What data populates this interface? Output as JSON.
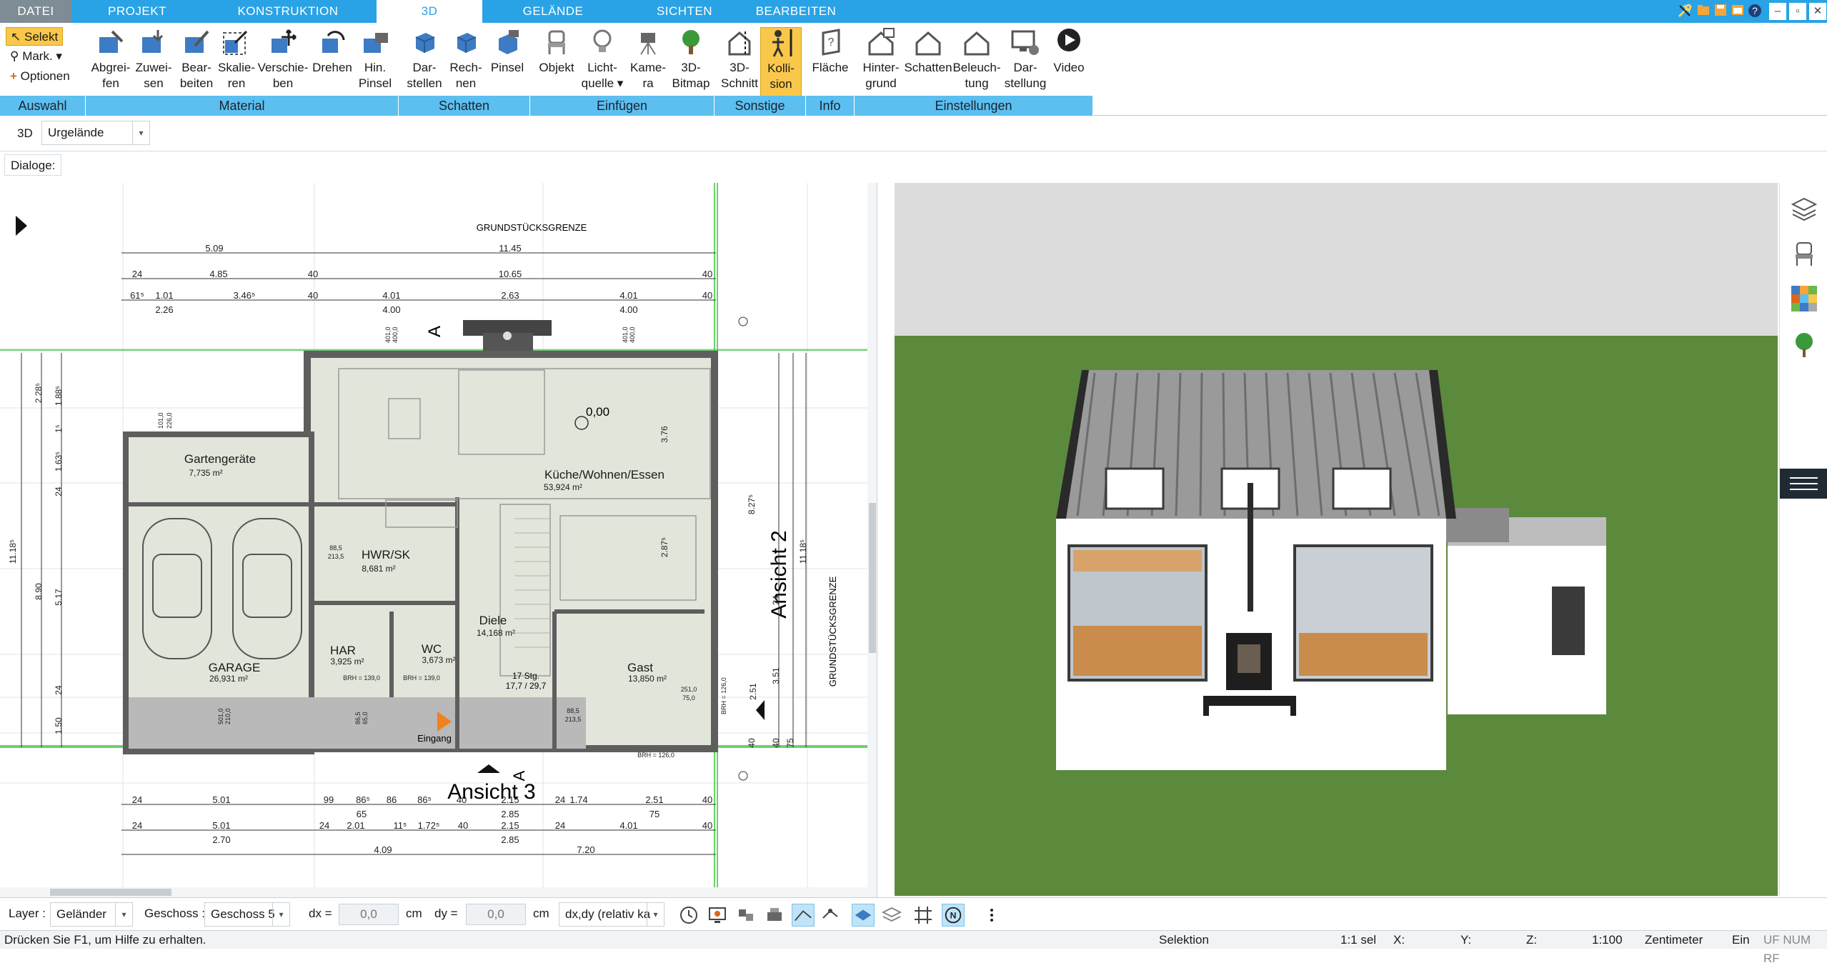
{
  "tabs": [
    {
      "label": "DATEI",
      "active": false
    },
    {
      "label": "PROJEKT",
      "active": false
    },
    {
      "label": "KONSTRUKTION",
      "active": false
    },
    {
      "label": "3D",
      "active": true
    },
    {
      "label": "GELÄNDE",
      "active": false
    },
    {
      "label": "SICHTEN",
      "active": false
    },
    {
      "label": "BEARBEITEN",
      "active": false
    }
  ],
  "auswahl": {
    "select": "Selekt",
    "mark": "Mark.",
    "options": "Optionen",
    "group": "Auswahl"
  },
  "ribbon": {
    "material": {
      "group": "Material",
      "buttons": [
        {
          "l1": "Abgrei-",
          "l2": "fen"
        },
        {
          "l1": "Zuwei-",
          "l2": "sen"
        },
        {
          "l1": "Bear-",
          "l2": "beiten"
        },
        {
          "l1": "Skalie-",
          "l2": "ren"
        },
        {
          "l1": "Verschie-",
          "l2": "ben"
        },
        {
          "l1": "Drehen",
          "l2": ""
        },
        {
          "l1": "Hin.",
          "l2": "Pinsel"
        }
      ]
    },
    "schatten": {
      "group": "Schatten",
      "buttons": [
        {
          "l1": "Dar-",
          "l2": "stellen"
        },
        {
          "l1": "Rech-",
          "l2": "nen"
        },
        {
          "l1": "Pinsel",
          "l2": ""
        }
      ]
    },
    "einfuegen": {
      "group": "Einfügen",
      "buttons": [
        {
          "l1": "Objekt",
          "l2": ""
        },
        {
          "l1": "Licht-",
          "l2": "quelle"
        },
        {
          "l1": "Kame-",
          "l2": "ra"
        },
        {
          "l1": "3D-",
          "l2": "Bitmap"
        }
      ]
    },
    "sonstige": {
      "group": "Sonstige",
      "buttons": [
        {
          "l1": "3D-",
          "l2": "Schnitt"
        },
        {
          "l1": "Kolli-",
          "l2": "sion"
        }
      ]
    },
    "info": {
      "group": "Info",
      "buttons": [
        {
          "l1": "Fläche",
          "l2": ""
        }
      ]
    },
    "einstellungen": {
      "group": "Einstellungen",
      "buttons": [
        {
          "l1": "Hinter-",
          "l2": "grund"
        },
        {
          "l1": "Schatten",
          "l2": ""
        },
        {
          "l1": "Beleuch-",
          "l2": "tung"
        },
        {
          "l1": "Dar-",
          "l2": "stellung"
        },
        {
          "l1": "Video",
          "l2": ""
        }
      ]
    }
  },
  "toolbar2": {
    "mode": "3D",
    "terrain_select": "Urgelände"
  },
  "dialoge": {
    "label": "Dialoge:"
  },
  "plan": {
    "title_top": "GRUNDSTÜCKSGRENZE",
    "title_right": "GRUNDSTÜCKSGRENZE",
    "ansicht3": "Ansicht 3",
    "ansicht2": "Ansicht 2",
    "section_a": "A",
    "level": "0,00",
    "entrance": "Eingang",
    "stairs1": "17 Stg.",
    "stairs2": "17,7 / 29,7",
    "rooms": [
      {
        "name": "Gartengeräte",
        "area": "7,735 m²"
      },
      {
        "name": "Küche/Wohnen/Essen",
        "area": "53,924 m²"
      },
      {
        "name": "HWR/SK",
        "area": "8,681 m²"
      },
      {
        "name": "Diele",
        "area": "14,168 m²"
      },
      {
        "name": "HAR",
        "area": "3,925 m²"
      },
      {
        "name": "WC",
        "area": "3,673 m²"
      },
      {
        "name": "GARAGE",
        "area": "26,931 m²"
      },
      {
        "name": "Gast",
        "area": "13,850 m²"
      }
    ],
    "dims_top1": [
      "5.09",
      "11.45"
    ],
    "dims_top2": [
      "24",
      "4.85",
      "40",
      "10.65",
      "40"
    ],
    "dims_top3": [
      "61⁵",
      "1.01",
      "3.46⁵",
      "40",
      "4.01",
      "2.63",
      "4.01",
      "40"
    ],
    "dims_top3b": [
      "2.26",
      "4.00",
      "4.00"
    ],
    "dims_bottom1": [
      "24",
      "5.01",
      "99",
      "86⁵",
      "86",
      "86⁵",
      "40",
      "2.15",
      "24",
      "1.74",
      "2.51",
      "40"
    ],
    "dims_bottom1b": [
      "65",
      "2.85",
      "75"
    ],
    "dims_bottom2": [
      "24",
      "5.01",
      "24",
      "2.01",
      "11⁵",
      "1.72⁵",
      "40",
      "2.15",
      "24",
      "4.01",
      "40"
    ],
    "dims_bottom2b": [
      "2.70",
      "2.85"
    ],
    "dims_bottom3": [
      "4.09",
      "7.20"
    ],
    "dims_left": [
      "11.18⁵",
      "2.28⁵",
      "8.90",
      "1.88⁵",
      "1⁵",
      "1.63⁵",
      "24",
      "5.17",
      "24",
      "1.50"
    ],
    "dims_right": [
      "8.27⁵",
      "11.18⁵",
      "24",
      "3.76",
      "2.87⁵",
      "2.51",
      "3.51",
      "40",
      "40",
      "75"
    ],
    "small_labels": [
      "88,5",
      "213,5",
      "BRH = 139,0",
      "BRH = 126,0",
      "101,0",
      "226,0",
      "251,0",
      "75,0",
      "401,0",
      "400,0",
      "501,0",
      "210,0",
      "86,5",
      "65,0"
    ]
  },
  "bottombar": {
    "layer_label": "Layer :",
    "layer_value": "Geländer",
    "floor_label": "Geschoss :",
    "floor_value": "Geschoss 5",
    "dx_label": "dx =",
    "dx_value": "0,0",
    "dy_label": "dy =",
    "dy_value": "0,0",
    "unit": "cm",
    "mode": "dx,dy (relativ ka"
  },
  "status": {
    "help": "Drücken Sie F1, um Hilfe zu erhalten.",
    "mode": "Selektion",
    "ratio": "1:1 sel",
    "x": "X:",
    "y": "Y:",
    "z": "Z:",
    "scale": "1:100",
    "unit": "Zentimeter",
    "ein": "Ein",
    "flags": "UF NUM RF"
  },
  "colors": {
    "accent": "#29a3e6",
    "group_band": "#5cbff0",
    "highlight": "#f9c84a",
    "grass": "#5b8a3c",
    "sky": "#dcdcdc",
    "room_fill": "#e2e6da",
    "wall": "#6c6c6c",
    "green_line": "#3ac23a"
  }
}
